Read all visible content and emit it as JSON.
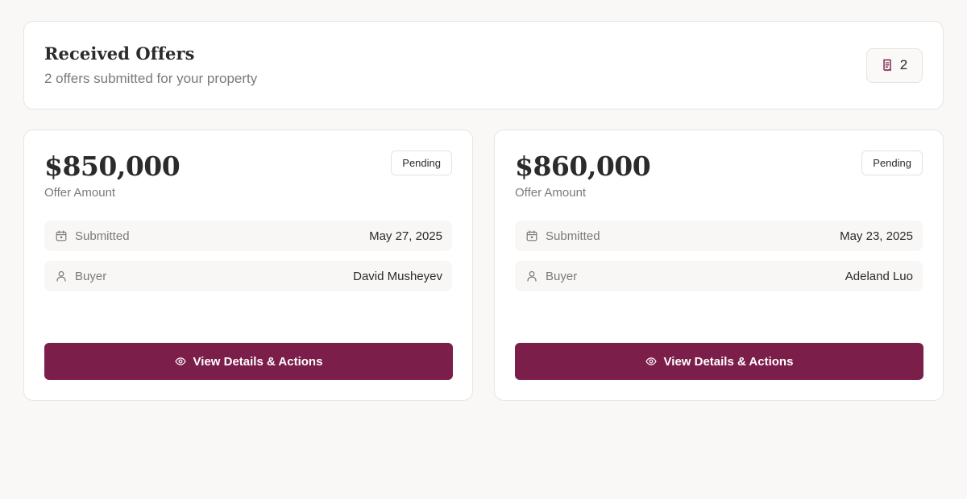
{
  "header": {
    "title": "Received Offers",
    "subtitle": "2 offers submitted for your property",
    "count": "2",
    "count_icon": "document-icon"
  },
  "offers": [
    {
      "amount": "$850,000",
      "amount_label": "Offer Amount",
      "status": "Pending",
      "submitted_label": "Submitted",
      "submitted_date": "May 27, 2025",
      "buyer_label": "Buyer",
      "buyer_name": "David Musheyev",
      "button_label": "View Details & Actions"
    },
    {
      "amount": "$860,000",
      "amount_label": "Offer Amount",
      "status": "Pending",
      "submitted_label": "Submitted",
      "submitted_date": "May 23, 2025",
      "buyer_label": "Buyer",
      "buyer_name": "Adeland Luo",
      "button_label": "View Details & Actions"
    }
  ],
  "colors": {
    "accent": "#7c1e4a",
    "background": "#f9f8f6",
    "card": "#ffffff",
    "muted_text": "#7a7a7a"
  }
}
